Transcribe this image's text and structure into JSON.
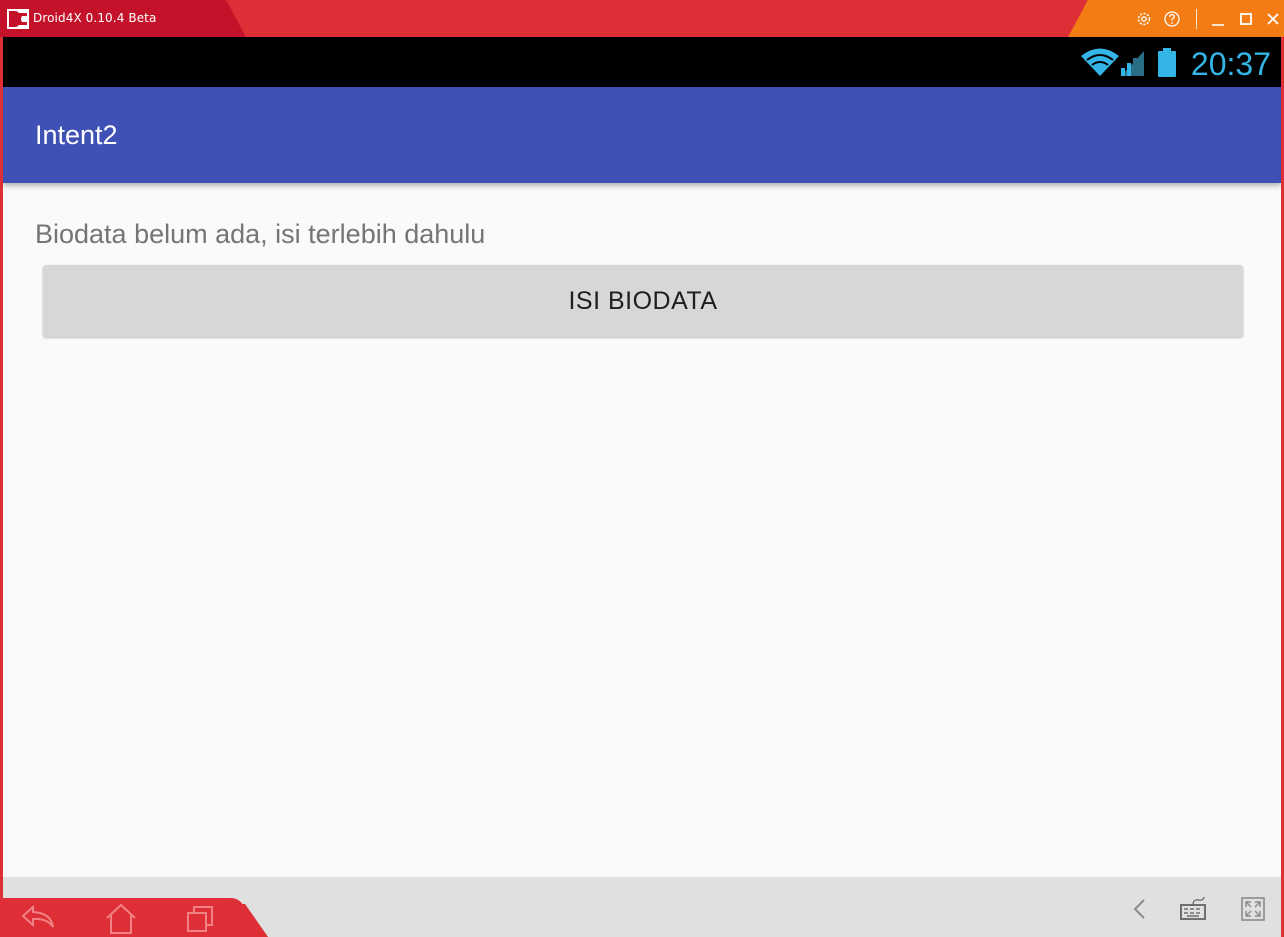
{
  "window": {
    "title": "Droid4X 0.10.4 Beta",
    "icons": [
      "droid4x-logo-icon",
      "settings-icon",
      "help-icon",
      "minimize-icon",
      "maximize-icon",
      "close-icon"
    ]
  },
  "status_bar": {
    "time": "20:37",
    "icons": [
      "wifi-icon",
      "signal-icon",
      "battery-icon"
    ]
  },
  "app_bar": {
    "title": "Intent2",
    "color": "#3f51b5"
  },
  "content": {
    "message": "Biodata belum ada, isi terlebih dahulu",
    "button_label": "ISI BIODATA"
  },
  "bottom_bar": {
    "left_icons": [
      "back-arrow-icon",
      "home-icon",
      "recent-apps-icon"
    ],
    "right_icons": [
      "chevron-left-icon",
      "keyboard-icon",
      "fullscreen-icon"
    ]
  },
  "colors": {
    "window_red": "#dd2f35",
    "window_orange": "#f47c14",
    "clock": "#33b5e5"
  }
}
